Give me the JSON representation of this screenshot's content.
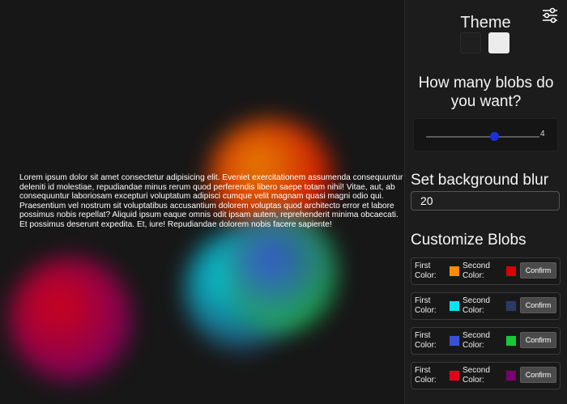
{
  "background": "#171717",
  "blobs": [
    {
      "first_color": "#ff8c00",
      "second_color": "#d80000"
    },
    {
      "first_color": "#00e8f0",
      "second_color": "#2a3a66"
    },
    {
      "first_color": "#3b4fd6",
      "second_color": "#18c836"
    },
    {
      "first_color": "#e3001a",
      "second_color": "#7a006f"
    }
  ],
  "lorem_text": "Lorem ipsum dolor sit amet consectetur adipisicing elit. Eveniet exercitationem assumenda consequuntur deleniti id molestiae, repudiandae minus rerum quod perferendis libero saepe totam nihil! Vitae, aut, ab consequuntur laboriosam excepturi voluptatum adipisci cumque velit magnam quasi magni odio qui. Praesentium vel nostrum sit voluptatibus accusantium dolorem voluptas quod architecto error et labore possimus nobis repellat? Aliquid ipsum eaque omnis odit ipsam autem, reprehenderit minima obcaecati. Et possimus deserunt expedita. Et, iure! Repudiandae dolorem nobis facere sapiente!",
  "panel": {
    "settings_icon": "sliders-icon",
    "theme_title": "Theme",
    "theme_options": [
      {
        "name": "dark",
        "color": "#1f1f1f"
      },
      {
        "name": "light",
        "color": "#ececec"
      }
    ],
    "blob_count_question": "How many blobs do you want?",
    "blob_count": "4",
    "blob_count_fraction": 0.6,
    "blur_title": "Set background blur",
    "blur_value": "20",
    "customize_title": "Customize Blobs",
    "first_color_label": "First Color:",
    "second_color_label": "Second Color:",
    "confirm_label": "Confirm"
  }
}
